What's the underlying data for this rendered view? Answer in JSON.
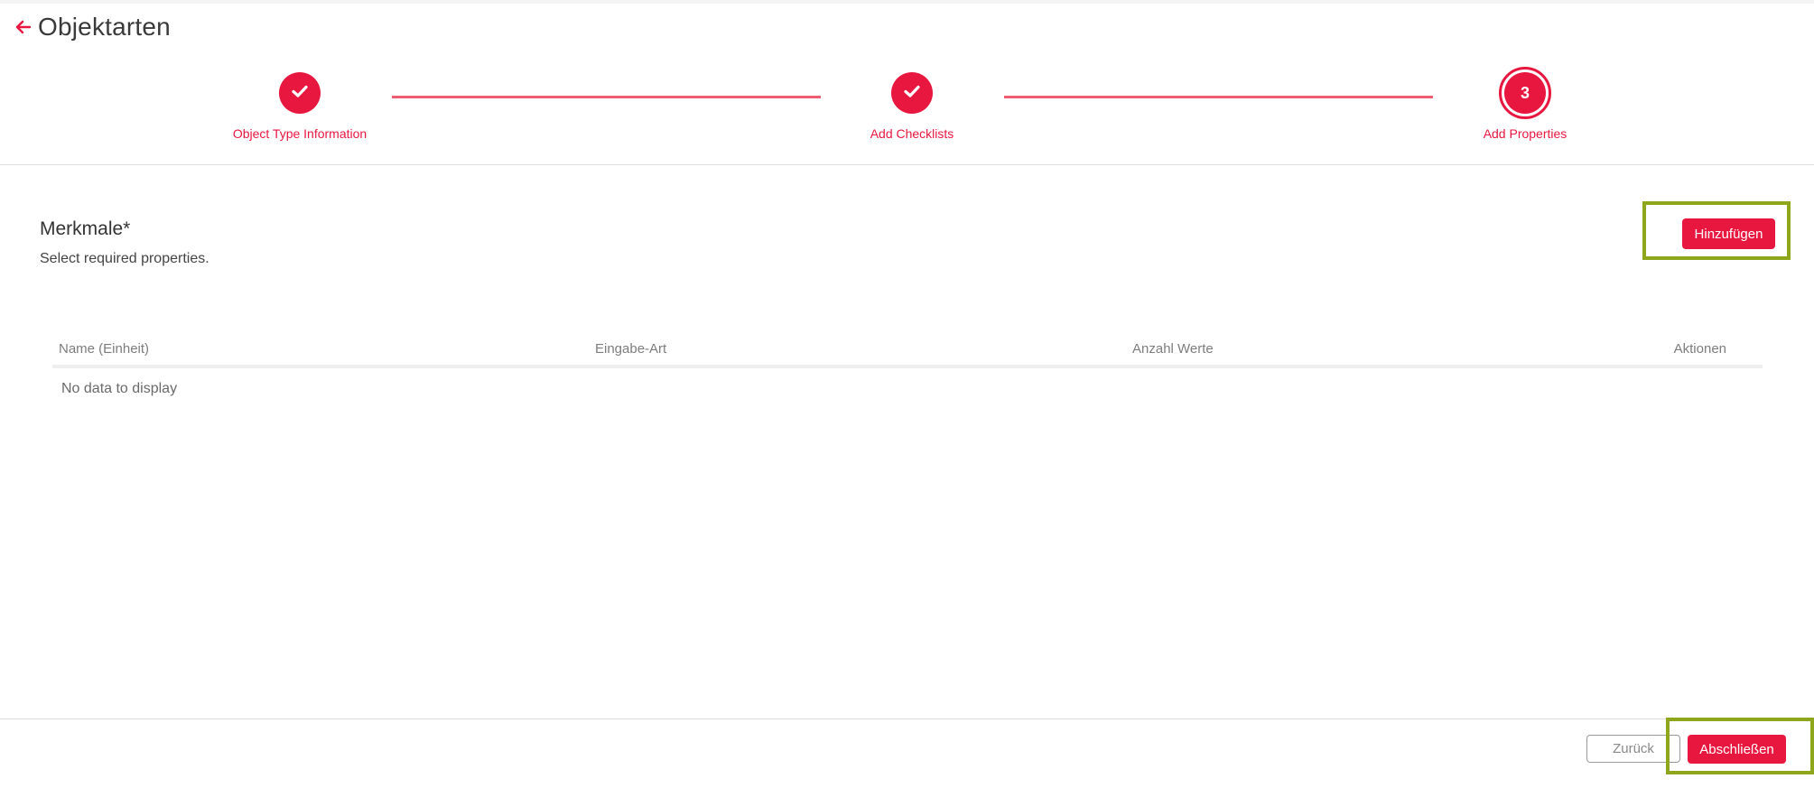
{
  "header": {
    "title": "Objektarten",
    "back_icon": "arrow-left-icon"
  },
  "stepper": {
    "steps": [
      {
        "label": "Object Type Information",
        "state": "completed",
        "icon": "check-icon"
      },
      {
        "label": "Add Checklists",
        "state": "completed",
        "icon": "check-icon"
      },
      {
        "label": "Add Properties",
        "state": "current",
        "number": "3"
      }
    ]
  },
  "section": {
    "title": "Merkmale*",
    "subtitle": "Select required properties.",
    "add_button_label": "Hinzufügen"
  },
  "table": {
    "columns": [
      "Name (Einheit)",
      "Eingabe-Art",
      "Anzahl Werte",
      "Aktionen"
    ],
    "empty_text": "No data to display"
  },
  "footer": {
    "back_label": "Zurück",
    "finish_label": "Abschließen"
  },
  "colors": {
    "accent": "#e8173f",
    "highlight": "#8ea61c"
  }
}
